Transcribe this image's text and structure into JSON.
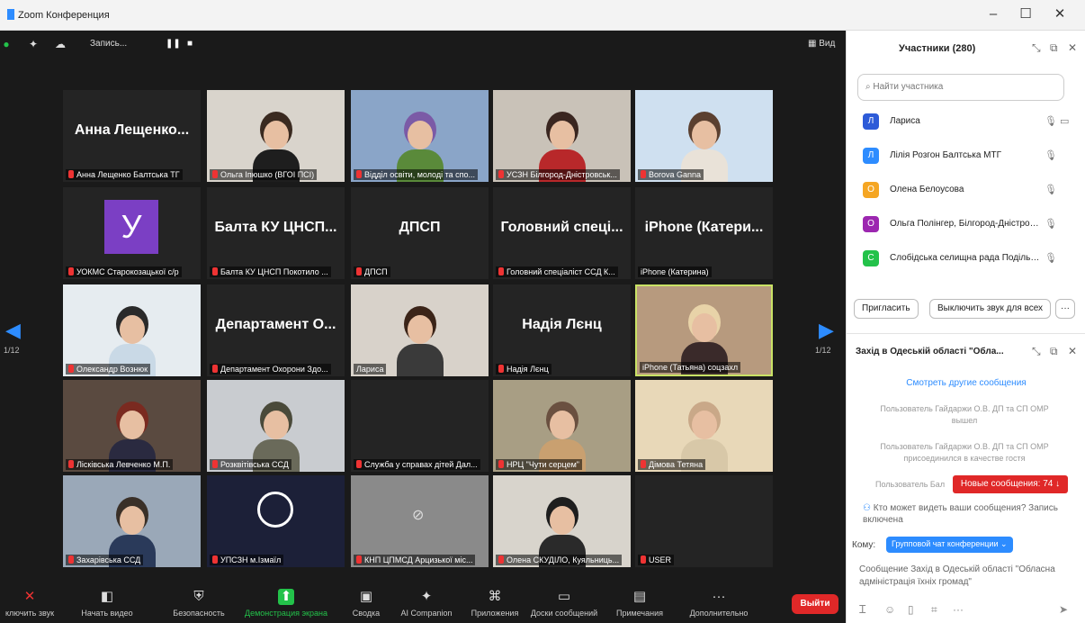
{
  "window": {
    "title": "Zoom Конференция",
    "controls": [
      "–",
      "☐",
      "✕"
    ]
  },
  "topbar": {
    "recording_label": "Запись...",
    "pause": "❚❚",
    "stop": "■",
    "view_label": "Вид"
  },
  "tiles": [
    {
      "name": "Анна Лещенко...",
      "caption": "Анна Лещенко Балтська ТГ",
      "muted": true,
      "video": false
    },
    {
      "name": "",
      "caption": "Ольга Іпюшко (ВГОІ ПСІ)",
      "muted": true,
      "video": true,
      "look": "woman-dark"
    },
    {
      "name": "",
      "caption": "Відділ освіти, молоді та спо...",
      "muted": true,
      "video": true,
      "look": "lavender"
    },
    {
      "name": "",
      "caption": "УСЗН Білгород-Дністровськ...",
      "muted": true,
      "video": true,
      "look": "woman-red"
    },
    {
      "name": "",
      "caption": "Borova Ganna",
      "muted": true,
      "video": true,
      "look": "woman-blue"
    },
    {
      "name": "",
      "caption": "УОКМС Старокозацької с/р",
      "muted": true,
      "video": false,
      "avatar": "У"
    },
    {
      "name": "Балта КУ ЦНСП...",
      "caption": "Балта КУ ЦНСП Покотило ...",
      "muted": true,
      "video": false
    },
    {
      "name": "ДПСП",
      "caption": "ДПСП",
      "muted": true,
      "video": false
    },
    {
      "name": "Головний спеці...",
      "caption": "Головний спеціаліст ССД К...",
      "muted": true,
      "video": false
    },
    {
      "name": "iPhone (Катери...",
      "caption": "iPhone (Катерина)",
      "muted": false,
      "video": false
    },
    {
      "name": "",
      "caption": "Олександр Вознюк",
      "muted": true,
      "video": true,
      "look": "man"
    },
    {
      "name": "Департамент О...",
      "caption": "Департамент Охорони Здо...",
      "muted": true,
      "video": false
    },
    {
      "name": "",
      "caption": "Лариса",
      "muted": false,
      "video": true,
      "look": "woman-glasses"
    },
    {
      "name": "Надія Лєнц",
      "caption": "Надія Лєнц",
      "muted": true,
      "video": false
    },
    {
      "name": "",
      "caption": "iPhone (Татьяна) соцзахл",
      "muted": false,
      "video": true,
      "look": "woman-blonde",
      "active": true
    },
    {
      "name": "",
      "caption": "Лісківська Левченко М.П.",
      "muted": true,
      "video": true,
      "look": "woman-red2"
    },
    {
      "name": "",
      "caption": "Розквітівська ССД",
      "muted": true,
      "video": true,
      "look": "trees"
    },
    {
      "name": "",
      "caption": "Служба у справах дітей Дал...",
      "muted": true,
      "video": false
    },
    {
      "name": "",
      "caption": "НРЦ \"Чути серцем\"",
      "muted": true,
      "video": true,
      "look": "room"
    },
    {
      "name": "",
      "caption": "Дімова Тетяна",
      "muted": true,
      "video": true,
      "look": "curtain"
    },
    {
      "name": "",
      "caption": "Захарівська ССД",
      "muted": true,
      "video": true,
      "look": "woman-blue2"
    },
    {
      "name": "",
      "caption": "УПСЗН м.Ізмаїл",
      "muted": true,
      "video": true,
      "look": "obs"
    },
    {
      "name": "",
      "caption": "КНП ЦПМСД Арцизької міс...",
      "muted": true,
      "video": true,
      "look": "novideo"
    },
    {
      "name": "",
      "caption": "Олена СКУДІЛО, Куяльниць...",
      "muted": true,
      "video": true,
      "look": "woman-scarf"
    },
    {
      "name": "",
      "caption": "USER",
      "muted": true,
      "video": false
    }
  ],
  "nav": {
    "left_page": "1/12",
    "right_page": "1/12"
  },
  "toolbar": {
    "items": [
      "ключить звук",
      "Начать видео",
      "Безопасность",
      "Демонстрация экрана",
      "Сводка",
      "AI Companion",
      "Приложения",
      "Доски сообщений",
      "Примечания",
      "Дополнительно"
    ],
    "leave": "Выйти"
  },
  "participants": {
    "title": "Участники (280)",
    "search_placeholder": "Найти участника",
    "items": [
      {
        "initial": "Л",
        "name": "Лариса",
        "color": "#2d5bd8"
      },
      {
        "initial": "Л",
        "name": "Лілія Розгон Балтська МТГ",
        "color": "#2d8cff"
      },
      {
        "initial": "О",
        "name": "Олена Белоусова",
        "color": "#f5a623"
      },
      {
        "initial": "О",
        "name": "Ольга Полінгер, Білгород-Дністровс...",
        "color": "#9c27b0"
      },
      {
        "initial": "С",
        "name": "Слобідська селищна рада Подільськ...",
        "color": "#23c24a"
      }
    ],
    "invite_btn": "Пригласить",
    "mute_all_btn": "Выключить звук для всех",
    "more_btn": "···"
  },
  "chat": {
    "title": "Захід в Одеській області \"Обла...",
    "see_other": "Смотреть другие сообщения",
    "system_messages": [
      "Пользователь Гайдаржи О.В. ДП та СП ОМР вышел",
      "Пользователь Гайдаржи О.В. ДП та СП ОМР присоединился в качестве гостя",
      "Пользователь Бал"
    ],
    "new_messages": "Новые сообщения: 74 ↓",
    "who_can_see": "Кто может видеть ваши сообщения? Запись включена",
    "to_label": "Кому:",
    "to_value": "Групповой чат конференции ⌄",
    "composer": "Сообщение Захід в Одеській області \"Обласна адміністрація їхніх громад\""
  }
}
